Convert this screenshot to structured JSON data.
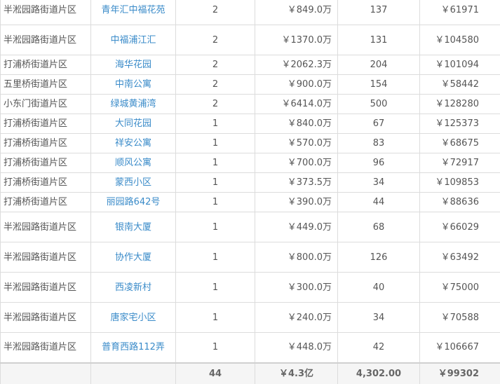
{
  "rows": [
    {
      "area": "半淞园路街道片区",
      "name": "青年汇中福花苑",
      "count": "2",
      "price": "￥849.0万",
      "size": "137",
      "unit": "￥61971"
    },
    {
      "area": "半淞园路街道片区",
      "name": "中福浦江汇",
      "count": "2",
      "price": "￥1370.0万",
      "size": "131",
      "unit": "￥104580"
    },
    {
      "area": "打浦桥街道片区",
      "name": "海华花园",
      "count": "2",
      "price": "￥2062.3万",
      "size": "204",
      "unit": "￥101094"
    },
    {
      "area": "五里桥街道片区",
      "name": "中南公寓",
      "count": "2",
      "price": "￥900.0万",
      "size": "154",
      "unit": "￥58442"
    },
    {
      "area": "小东门街道片区",
      "name": "绿城黄浦湾",
      "count": "2",
      "price": "￥6414.0万",
      "size": "500",
      "unit": "￥128280"
    },
    {
      "area": "打浦桥街道片区",
      "name": "大同花园",
      "count": "1",
      "price": "￥840.0万",
      "size": "67",
      "unit": "￥125373"
    },
    {
      "area": "打浦桥街道片区",
      "name": "祥安公寓",
      "count": "1",
      "price": "￥570.0万",
      "size": "83",
      "unit": "￥68675"
    },
    {
      "area": "打浦桥街道片区",
      "name": "顺风公寓",
      "count": "1",
      "price": "￥700.0万",
      "size": "96",
      "unit": "￥72917"
    },
    {
      "area": "打浦桥街道片区",
      "name": "蒙西小区",
      "count": "1",
      "price": "￥373.5万",
      "size": "34",
      "unit": "￥109853"
    },
    {
      "area": "打浦桥街道片区",
      "name": "丽园路642号",
      "count": "1",
      "price": "￥390.0万",
      "size": "44",
      "unit": "￥88636"
    },
    {
      "area": "半淞园路街道片区",
      "name": "银南大厦",
      "count": "1",
      "price": "￥449.0万",
      "size": "68",
      "unit": "￥66029"
    },
    {
      "area": "半淞园路街道片区",
      "name": "协作大厦",
      "count": "1",
      "price": "￥800.0万",
      "size": "126",
      "unit": "￥63492"
    },
    {
      "area": "半淞园路街道片区",
      "name": "西凌新村",
      "count": "1",
      "price": "￥300.0万",
      "size": "40",
      "unit": "￥75000"
    },
    {
      "area": "半淞园路街道片区",
      "name": "唐家宅小区",
      "count": "1",
      "price": "￥240.0万",
      "size": "34",
      "unit": "￥70588"
    },
    {
      "area": "半淞园路街道片区",
      "name": "普育西路112弄",
      "count": "1",
      "price": "￥448.0万",
      "size": "42",
      "unit": "￥106667"
    }
  ],
  "summary": {
    "count": "44",
    "price": "￥4.3亿",
    "size": "4,302.00",
    "unit": "￥99302"
  }
}
